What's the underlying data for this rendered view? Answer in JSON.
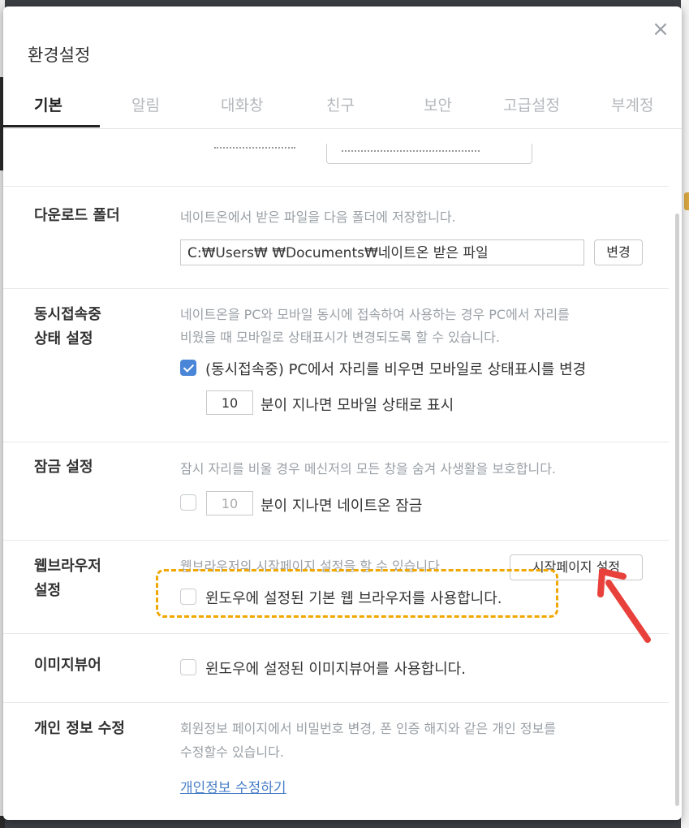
{
  "dialog": {
    "title": "환경설정",
    "close_label": "×"
  },
  "tabs": [
    {
      "label": "기본",
      "active": true
    },
    {
      "label": "알림",
      "active": false
    },
    {
      "label": "대화창",
      "active": false
    },
    {
      "label": "친구",
      "active": false
    },
    {
      "label": "보안",
      "active": false
    },
    {
      "label": "고급설정",
      "active": false
    },
    {
      "label": "부계정",
      "active": false
    }
  ],
  "download": {
    "label": "다운로드 폴더",
    "desc": "네이트온에서 받은 파일을 다음 폴더에 저장합니다.",
    "path": "C:₩Users₩       ₩Documents₩네이트온 받은 파일",
    "change_btn": "변경"
  },
  "concurrent": {
    "label_line1": "동시접속중",
    "label_line2": "상태 설정",
    "desc_line1": "네이트온을 PC와 모바일 동시에 접속하여 사용하는 경우 PC에서 자리를",
    "desc_line2": "비웠을 때 모바일로 상태표시가 변경되도록 할 수 있습니다.",
    "checkbox_label": "(동시접속중) PC에서 자리를 비우면 모바일로 상태표시를 변경",
    "checked": true,
    "minutes": "10",
    "minutes_suffix": "분이 지나면 모바일 상태로 표시"
  },
  "lock": {
    "label": "잠금 설정",
    "desc": "잠시 자리를 비울 경우 메신저의 모든 창을 숨겨 사생활을 보호합니다.",
    "checked": false,
    "minutes": "10",
    "minutes_suffix": "분이 지나면 네이트온 잠금"
  },
  "browser": {
    "label_line1": "웹브라우저",
    "label_line2": "설정",
    "desc": "웹브라우저의 시작페이지 설정을 할 수 있습니다.",
    "start_page_btn": "시작페이지 설정",
    "checkbox_label": "윈도우에 설정된 기본 웹 브라우저를 사용합니다.",
    "checked": false
  },
  "image_viewer": {
    "label": "이미지뷰어",
    "checkbox_label": "윈도우에 설정된 이미지뷰어를 사용합니다.",
    "checked": false
  },
  "privacy": {
    "label": "개인 정보 수정",
    "desc_line1": "회원정보 페이지에서 비밀번호 변경, 폰 인증 해지와 같은 개인 정보를",
    "desc_line2": "수정할수 있습니다.",
    "link": "개인정보 수정하기"
  },
  "colors": {
    "accent": "#4a86d8",
    "highlight": "#f0a800",
    "arrow": "#e8413c",
    "link": "#4a7fc8"
  }
}
